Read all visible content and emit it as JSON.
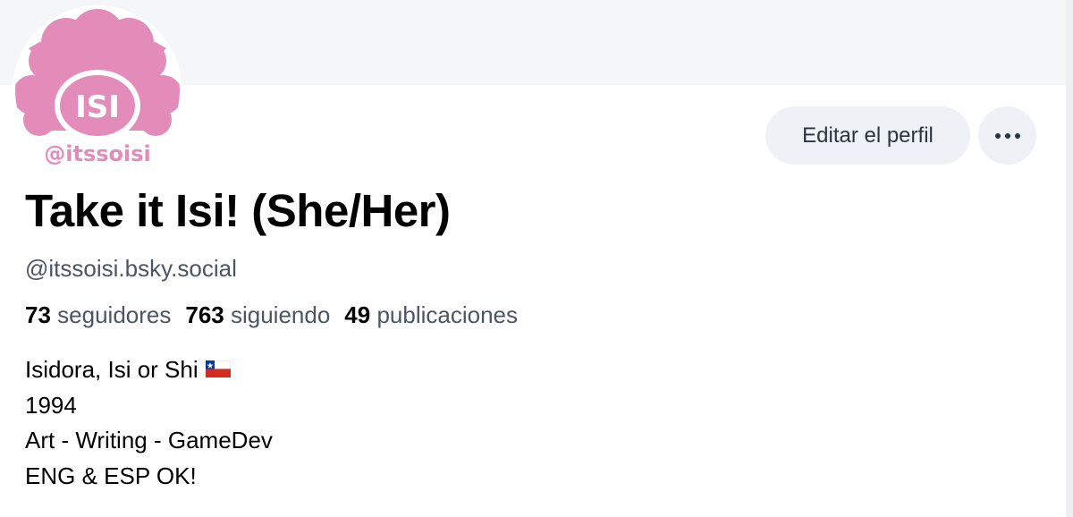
{
  "profile": {
    "avatar_text": "ISI",
    "avatar_caption": "@itssoisi",
    "display_name": "Take it Isi! (She/Her)",
    "handle": "@itssoisi.bsky.social"
  },
  "actions": {
    "edit_profile_label": "Editar el perfil",
    "more_icon": "ellipsis-icon"
  },
  "stats": [
    {
      "count": "73",
      "label": "seguidores"
    },
    {
      "count": "763",
      "label": "siguiendo"
    },
    {
      "count": "49",
      "label": "publicaciones"
    }
  ],
  "bio": {
    "lines": [
      "Isidora, Isi or Shi",
      "1994",
      "Art - Writing - GameDev",
      "ENG & ESP OK!"
    ],
    "flag_icon": "chile-flag-icon"
  },
  "colors": {
    "avatar_pink": "#e48cb9",
    "banner": "#f5f6f8",
    "button_bg": "#eef1f5",
    "muted_text": "#4b5565"
  }
}
